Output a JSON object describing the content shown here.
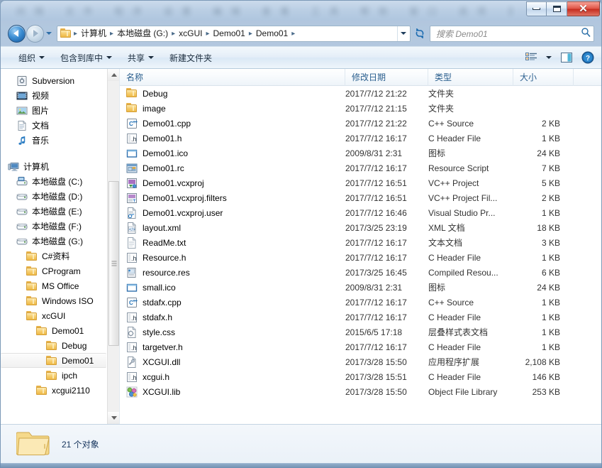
{
  "window": {
    "title_blurred": true,
    "title_ghost_text": "间隔 文件 程序 设置 编辑 查看 工具 帮助 窗口 选项 显示",
    "buttons": {
      "minimize": "minimize",
      "maximize": "maximize",
      "close": "✕"
    }
  },
  "address_bar": {
    "back_tooltip": "后退",
    "forward_tooltip": "前进",
    "breadcrumb_separator": "▸",
    "crumbs": [
      "计算机",
      "本地磁盘 (G:)",
      "xcGUI",
      "Demo01",
      "Demo01"
    ],
    "refresh_glyph": "↻",
    "search": {
      "placeholder": "搜索 Demo01",
      "value": ""
    }
  },
  "toolbar": {
    "items": [
      {
        "label": "组织",
        "has_caret": true
      },
      {
        "label": "包含到库中",
        "has_caret": true
      },
      {
        "label": "共享",
        "has_caret": true
      },
      {
        "label": "新建文件夹",
        "has_caret": false
      }
    ],
    "view_button": "view-options",
    "preview_button": "preview-pane",
    "help_button": "?"
  },
  "nav_pane": {
    "items": [
      {
        "label": "Subversion",
        "icon": "subversion-icon",
        "indent": 1,
        "selected": false
      },
      {
        "label": "视频",
        "icon": "video-icon",
        "indent": 1,
        "selected": false
      },
      {
        "label": "图片",
        "icon": "picture-icon",
        "indent": 1,
        "selected": false
      },
      {
        "label": "文档",
        "icon": "document-icon",
        "indent": 1,
        "selected": false
      },
      {
        "label": "音乐",
        "icon": "music-icon",
        "indent": 1,
        "selected": false
      },
      {
        "label": "",
        "icon": "spacer",
        "indent": 0,
        "selected": false
      },
      {
        "label": "计算机",
        "icon": "computer-icon",
        "indent": 0,
        "selected": false
      },
      {
        "label": "本地磁盘 (C:)",
        "icon": "system-drive-icon",
        "indent": 1,
        "selected": false
      },
      {
        "label": "本地磁盘 (D:)",
        "icon": "drive-icon",
        "indent": 1,
        "selected": false
      },
      {
        "label": "本地磁盘 (E:)",
        "icon": "drive-icon",
        "indent": 1,
        "selected": false
      },
      {
        "label": "本地磁盘 (F:)",
        "icon": "drive-icon",
        "indent": 1,
        "selected": false
      },
      {
        "label": "本地磁盘 (G:)",
        "icon": "drive-icon",
        "indent": 1,
        "selected": false
      },
      {
        "label": "C#资料",
        "icon": "folder-icon",
        "indent": 2,
        "selected": false
      },
      {
        "label": "CProgram",
        "icon": "folder-icon",
        "indent": 2,
        "selected": false
      },
      {
        "label": "MS Office",
        "icon": "folder-icon",
        "indent": 2,
        "selected": false
      },
      {
        "label": "Windows ISO",
        "icon": "folder-icon",
        "indent": 2,
        "selected": false
      },
      {
        "label": "xcGUI",
        "icon": "folder-icon",
        "indent": 2,
        "selected": false
      },
      {
        "label": "Demo01",
        "icon": "folder-icon",
        "indent": 3,
        "selected": false
      },
      {
        "label": "Debug",
        "icon": "folder-icon",
        "indent": 4,
        "selected": false
      },
      {
        "label": "Demo01",
        "icon": "folder-icon",
        "indent": 4,
        "selected": true
      },
      {
        "label": "ipch",
        "icon": "folder-icon",
        "indent": 4,
        "selected": false
      },
      {
        "label": "xcgui2110",
        "icon": "folder-icon",
        "indent": 3,
        "selected": false
      }
    ],
    "scrollbar": {
      "up_arrow": "▲",
      "down_arrow": "▼"
    }
  },
  "file_list": {
    "columns": [
      "名称",
      "修改日期",
      "类型",
      "大小"
    ],
    "sort_column": "名称",
    "rows": [
      {
        "name": "Debug",
        "date": "2017/7/12 21:22",
        "type": "文件夹",
        "size": "",
        "icon": "folder-icon"
      },
      {
        "name": "image",
        "date": "2017/7/12 21:15",
        "type": "文件夹",
        "size": "",
        "icon": "folder-icon"
      },
      {
        "name": "Demo01.cpp",
        "date": "2017/7/12 21:22",
        "type": "C++ Source",
        "size": "2 KB",
        "icon": "cpp-source-icon"
      },
      {
        "name": "Demo01.h",
        "date": "2017/7/12 16:17",
        "type": "C Header File",
        "size": "1 KB",
        "icon": "c-header-icon"
      },
      {
        "name": "Demo01.ico",
        "date": "2009/8/31 2:31",
        "type": "图标",
        "size": "24 KB",
        "icon": "ico-icon"
      },
      {
        "name": "Demo01.rc",
        "date": "2017/7/12 16:17",
        "type": "Resource Script",
        "size": "7 KB",
        "icon": "resource-script-icon"
      },
      {
        "name": "Demo01.vcxproj",
        "date": "2017/7/12 16:51",
        "type": "VC++ Project",
        "size": "5 KB",
        "icon": "vcxproj-icon"
      },
      {
        "name": "Demo01.vcxproj.filters",
        "date": "2017/7/12 16:51",
        "type": "VC++ Project Fil...",
        "size": "2 KB",
        "icon": "vcxproj-filters-icon"
      },
      {
        "name": "Demo01.vcxproj.user",
        "date": "2017/7/12 16:46",
        "type": "Visual Studio Pr...",
        "size": "1 KB",
        "icon": "vcxproj-user-icon"
      },
      {
        "name": "layout.xml",
        "date": "2017/3/25 23:19",
        "type": "XML 文档",
        "size": "18 KB",
        "icon": "xml-icon"
      },
      {
        "name": "ReadMe.txt",
        "date": "2017/7/12 16:17",
        "type": "文本文档",
        "size": "3 KB",
        "icon": "txt-icon"
      },
      {
        "name": "Resource.h",
        "date": "2017/7/12 16:17",
        "type": "C Header File",
        "size": "1 KB",
        "icon": "c-header-icon"
      },
      {
        "name": "resource.res",
        "date": "2017/3/25 16:45",
        "type": "Compiled Resou...",
        "size": "6 KB",
        "icon": "res-icon"
      },
      {
        "name": "small.ico",
        "date": "2009/8/31 2:31",
        "type": "图标",
        "size": "24 KB",
        "icon": "ico-icon"
      },
      {
        "name": "stdafx.cpp",
        "date": "2017/7/12 16:17",
        "type": "C++ Source",
        "size": "1 KB",
        "icon": "cpp-source-icon"
      },
      {
        "name": "stdafx.h",
        "date": "2017/7/12 16:17",
        "type": "C Header File",
        "size": "1 KB",
        "icon": "c-header-icon"
      },
      {
        "name": "style.css",
        "date": "2015/6/5 17:18",
        "type": "层叠样式表文档",
        "size": "1 KB",
        "icon": "css-icon"
      },
      {
        "name": "targetver.h",
        "date": "2017/7/12 16:17",
        "type": "C Header File",
        "size": "1 KB",
        "icon": "c-header-icon"
      },
      {
        "name": "XCGUI.dll",
        "date": "2017/3/28 15:50",
        "type": "应用程序扩展",
        "size": "2,108 KB",
        "icon": "dll-icon"
      },
      {
        "name": "xcgui.h",
        "date": "2017/3/28 15:51",
        "type": "C Header File",
        "size": "146 KB",
        "icon": "c-header-icon"
      },
      {
        "name": "XCGUI.lib",
        "date": "2017/3/28 15:50",
        "type": "Object File Library",
        "size": "253 KB",
        "icon": "lib-icon"
      }
    ]
  },
  "status_bar": {
    "text": "21 个对象",
    "icon": "open-folder-icon"
  },
  "colors": {
    "accent": "#2b5f8e",
    "folder_yellow": "#f6cf72",
    "close_red": "#c62f21",
    "selection_gray": "#f1f1f1"
  }
}
